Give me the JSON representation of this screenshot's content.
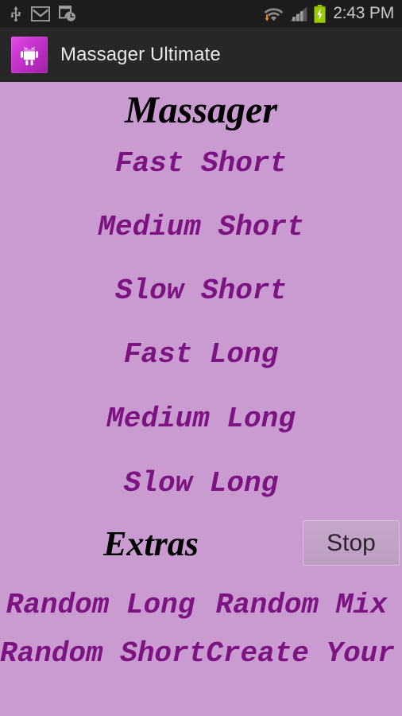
{
  "status_bar": {
    "icons": [
      "usb-icon",
      "gmail-icon",
      "device-clock-icon"
    ],
    "right_icons": [
      "wifi-download-icon",
      "signal-bars-icon",
      "battery-charging-icon"
    ],
    "time": "2:43 PM"
  },
  "title_bar": {
    "app_title": "Massager Ultimate",
    "app_icon": "android-robot-icon"
  },
  "content": {
    "heading_main": "Massager",
    "heading_extras": "Extras",
    "stop_button": "Stop",
    "menu_items": [
      {
        "label": "Fast Short"
      },
      {
        "label": "Medium Short"
      },
      {
        "label": "Slow Short"
      },
      {
        "label": "Fast Long"
      },
      {
        "label": "Medium Long"
      },
      {
        "label": "Slow Long"
      }
    ],
    "extra_items": [
      {
        "label": "Random Long"
      },
      {
        "label": "Random Mix"
      },
      {
        "label": "Random Short"
      },
      {
        "label": "Create Your Own"
      }
    ]
  },
  "colors": {
    "background": "#C99BD0",
    "menu_text": "#7D1382",
    "heading_text": "#000000",
    "status_bar": "#1C1C1C",
    "title_bar": "#272727",
    "accent": "#CB36D2",
    "battery_green": "#99CC00"
  }
}
